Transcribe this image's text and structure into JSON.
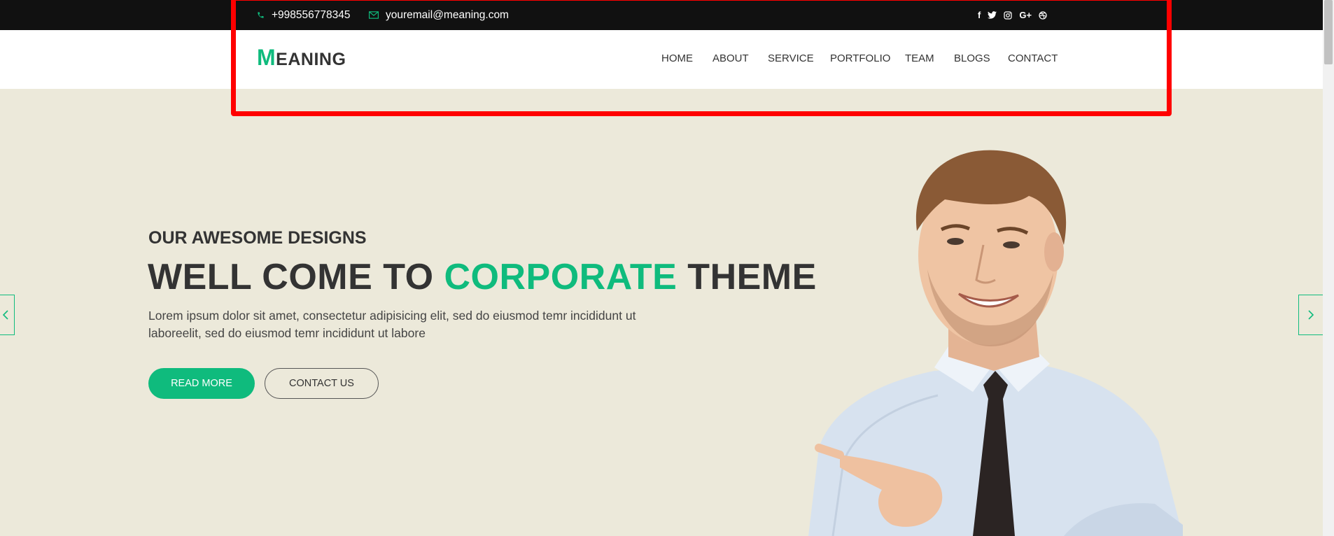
{
  "topbar": {
    "phone": "+998556778345",
    "email": "youremail@meaning.com",
    "social_icons": [
      "facebook-icon",
      "twitter-icon",
      "instagram-icon",
      "google-plus-icon",
      "dribbble-icon"
    ]
  },
  "logo": {
    "initial": "M",
    "rest": "EANING"
  },
  "nav": [
    "HOME",
    "ABOUT",
    "SERVICE",
    "PORTFOLIO",
    "TEAM",
    "BLOGS",
    "CONTACT"
  ],
  "hero": {
    "subtitle": "OUR AWESOME DESIGNS",
    "headline_pre": "WELL COME TO ",
    "headline_accent": "CORPORATE",
    "headline_post": " THEME",
    "paragraph": "Lorem ipsum dolor sit amet, consectetur adipisicing elit, sed do eiusmod temr incididunt ut laboreelit, sed do eiusmod temr incididunt ut labore",
    "read_more": "READ MORE",
    "contact_us": "CONTACT US"
  },
  "colors": {
    "accent": "#0fbb7d",
    "topbar_bg": "#111111",
    "hero_bg": "#ece9da",
    "highlight_box": "#ff0000"
  }
}
